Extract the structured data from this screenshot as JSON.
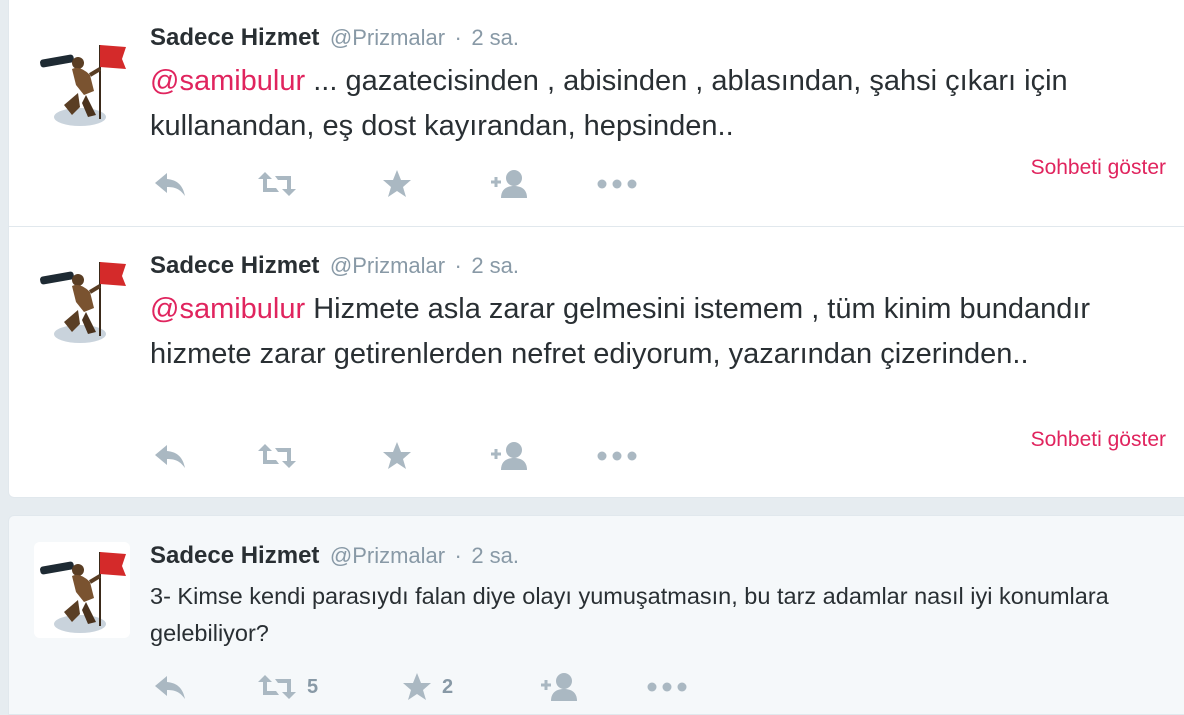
{
  "accent_color": "#e0245e",
  "tweets": [
    {
      "author_name": "Sadece Hizmet",
      "handle": "@Prizmalar",
      "separator": "·",
      "time": "2 sa.",
      "mention": "@samibulur",
      "text_rest": " ... gazatecisinden , abisinden , ablasından, şahsi çıkarı için kullanandan, eş dost kayırandan, hepsinden..",
      "show_conversation": "Sohbeti göster",
      "retweet_count": "",
      "favorite_count": "",
      "icons": [
        "reply-icon",
        "retweet-icon",
        "star-icon",
        "follow-icon",
        "more-icon"
      ]
    },
    {
      "author_name": "Sadece Hizmet",
      "handle": "@Prizmalar",
      "separator": "·",
      "time": "2 sa.",
      "mention": "@samibulur",
      "text_rest": " Hizmete asla zarar gelmesini istemem , tüm kinim bundandır hizmete zarar getirenlerden nefret ediyorum, yazarından çizerinden..",
      "show_conversation": "Sohbeti göster",
      "retweet_count": "",
      "favorite_count": "",
      "icons": [
        "reply-icon",
        "retweet-icon",
        "star-icon",
        "follow-icon",
        "more-icon"
      ]
    },
    {
      "author_name": "Sadece Hizmet",
      "handle": "@Prizmalar",
      "separator": "·",
      "time": "2 sa.",
      "text": "3- Kimse kendi parasıydı falan diye olayı yumuşatmasın, bu tarz adamlar nasıl iyi konumlara gelebiliyor?",
      "retweet_count": "5",
      "favorite_count": "2",
      "icons": [
        "reply-icon",
        "retweet-icon",
        "star-icon",
        "follow-icon",
        "more-icon"
      ]
    }
  ]
}
